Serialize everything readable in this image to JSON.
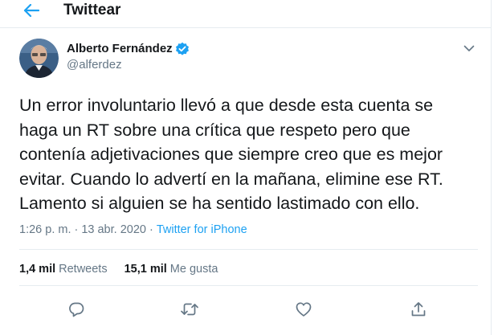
{
  "header": {
    "title": "Twittear",
    "back_icon": "arrow-left-icon"
  },
  "tweet": {
    "author": {
      "name": "Alberto Fernández",
      "handle": "@alferdez",
      "verified": true,
      "avatar_icon": "user-avatar"
    },
    "text": "Un error involuntario llevó a que desde esta cuenta se\nhaga un RT sobre una crítica que respeto pero que\ncontenía adjetivaciones que siempre creo que es mejor\nevitar. Cuando lo advertí en la mañana, elimine ese RT.\nLamento si alguien se ha sentido lastimado con ello.",
    "time": "1:26 p. m.",
    "separator": "·",
    "date": "13 abr. 2020",
    "source": "Twitter for iPhone",
    "stats": {
      "retweets_count": "1,4 mil",
      "retweets_label": "Retweets",
      "likes_count": "15,1 mil",
      "likes_label": "Me gusta"
    },
    "actions": [
      "reply-icon",
      "retweet-icon",
      "like-icon",
      "share-icon"
    ]
  },
  "colors": {
    "accent": "#1da1f2",
    "text_primary": "#14171a",
    "text_secondary": "#657786",
    "divider": "#e6ecf0"
  }
}
